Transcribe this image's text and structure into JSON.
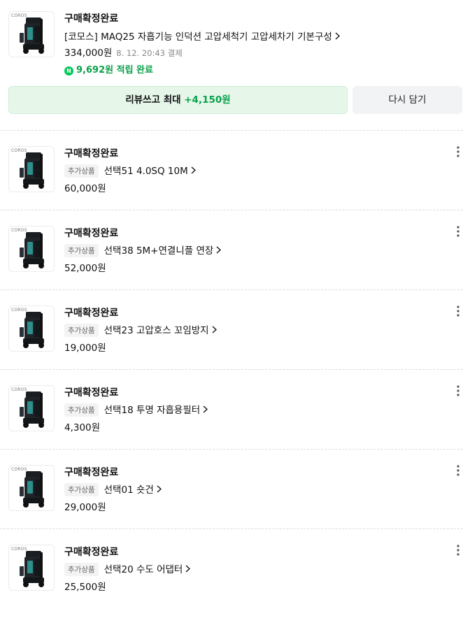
{
  "first_order": {
    "status": "구매확정완료",
    "title": "[코모스] MAQ25 자흡기능 인덕션 고압세척기 고압세차기 기본구성",
    "price": "334,000원",
    "date": "8. 12. 20:43 결제",
    "points_badge": "N",
    "points_text": "9,692원 적립 완료",
    "review_button": {
      "label": "리뷰쓰고 최대 ",
      "accent": "+4,150원"
    },
    "rebuy_button": "다시 담기",
    "thumb_brand": "COROS"
  },
  "sub_orders": [
    {
      "status": "구매확정완료",
      "tag": "추가상품",
      "title": "선택51 4.0SQ 10M",
      "price": "60,000원",
      "thumb_brand": "COROS"
    },
    {
      "status": "구매확정완료",
      "tag": "추가상품",
      "title": "선택38 5M+연결니플 연장",
      "price": "52,000원",
      "thumb_brand": "COROS"
    },
    {
      "status": "구매확정완료",
      "tag": "추가상품",
      "title": "선택23 고압호스 꼬임방지",
      "price": "19,000원",
      "thumb_brand": "COROS"
    },
    {
      "status": "구매확정완료",
      "tag": "추가상품",
      "title": "선택18 투명 자흡용필터",
      "price": "4,300원",
      "thumb_brand": "COROS"
    },
    {
      "status": "구매확정완료",
      "tag": "추가상품",
      "title": "선택01 숏건",
      "price": "29,000원",
      "thumb_brand": "COROS"
    },
    {
      "status": "구매확정완료",
      "tag": "추가상품",
      "title": "선택20 수도 어댑터",
      "price": "25,500원",
      "thumb_brand": "COROS"
    }
  ],
  "icons": {
    "chevron": "chevron-right-icon",
    "more": "more-vertical-icon"
  }
}
